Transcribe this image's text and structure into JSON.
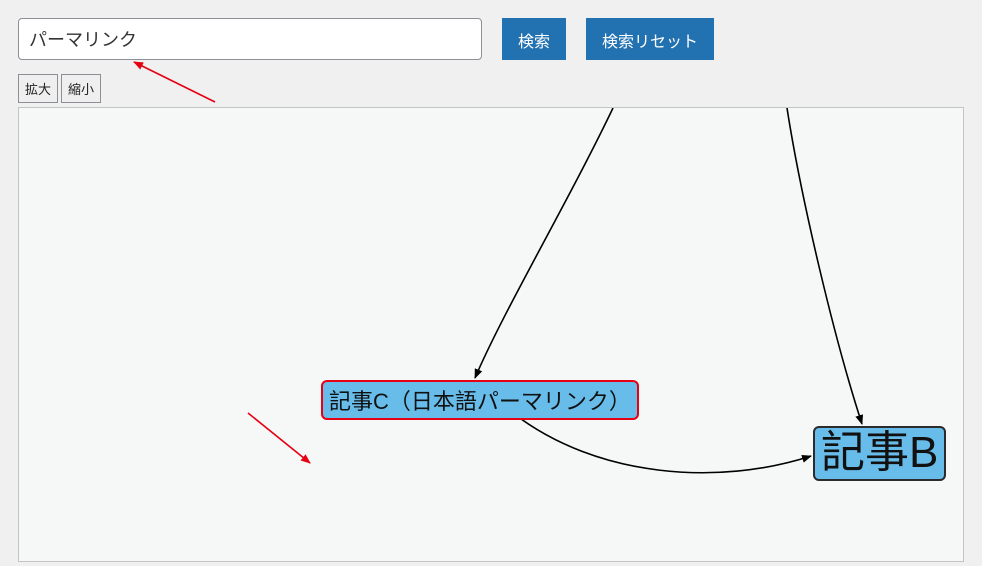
{
  "search": {
    "value": "パーマリンク",
    "placeholder": ""
  },
  "buttons": {
    "search_label": "検索",
    "reset_label": "検索リセット",
    "zoom_in_label": "拡大",
    "zoom_out_label": "縮小"
  },
  "graph": {
    "nodes": {
      "c": {
        "label": "記事C（日本語パーマリンク）",
        "highlighted": true
      },
      "b": {
        "label": "記事B",
        "highlighted": false
      }
    }
  },
  "chart_data": {
    "type": "diagram",
    "description": "Directed graph of linked articles",
    "nodes": [
      {
        "id": "C",
        "label": "記事C（日本語パーマリンク）",
        "highlighted": true
      },
      {
        "id": "B",
        "label": "記事B",
        "highlighted": false
      }
    ],
    "edges": [
      {
        "from": "offscreen-top-left",
        "to": "C"
      },
      {
        "from": "offscreen-top-right",
        "to": "B"
      },
      {
        "from": "C",
        "to": "B"
      }
    ],
    "search_term": "パーマリンク"
  }
}
